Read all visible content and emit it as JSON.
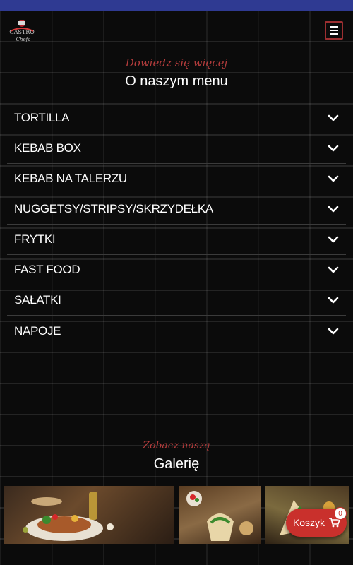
{
  "header": {
    "logo_icon": "gastro-chef-logo",
    "menu_icon": "hamburger-icon"
  },
  "menu_section": {
    "kicker": "Dowiedz się więcej",
    "title": "O naszym menu",
    "items": [
      {
        "label": "TORTILLA"
      },
      {
        "label": "KEBAB BOX"
      },
      {
        "label": "KEBAB NA TALERZU"
      },
      {
        "label": "NUGGETSY/STRIPSY/SKRZYDEŁKA"
      },
      {
        "label": "FRYTKI"
      },
      {
        "label": "FAST FOOD"
      },
      {
        "label": "SAŁATKI"
      },
      {
        "label": "NAPOJE"
      }
    ]
  },
  "gallery_section": {
    "kicker": "Zobacz naszą",
    "title": "Galerię",
    "images": [
      "kebab-plate-photo",
      "tortilla-wrap-photo",
      "fast-food-photo"
    ]
  },
  "cart": {
    "label": "Koszyk",
    "count": "0",
    "icon": "cart-icon"
  },
  "colors": {
    "top_bar": "#2f3a92",
    "accent": "#b33c3c",
    "cart": "#c9302c"
  }
}
